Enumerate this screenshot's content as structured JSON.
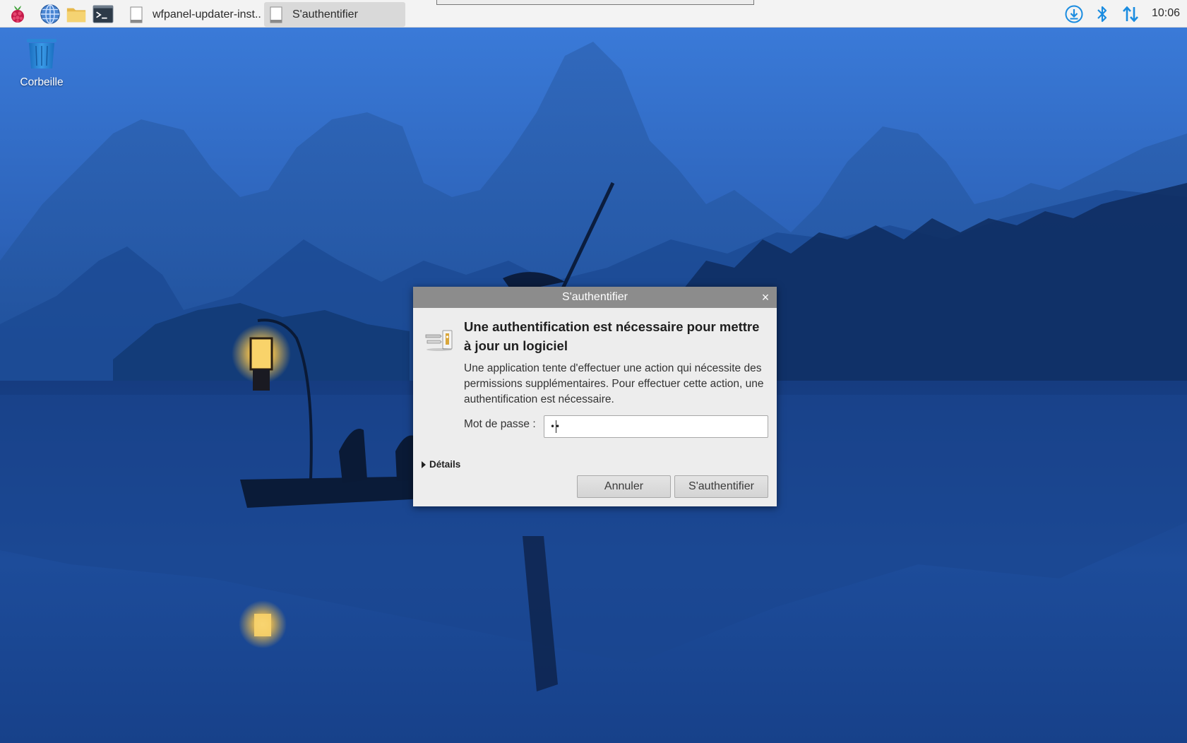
{
  "taskbar": {
    "launchers": [
      {
        "name": "raspberry-menu-icon"
      },
      {
        "name": "web-browser-icon"
      },
      {
        "name": "file-manager-icon"
      },
      {
        "name": "terminal-icon"
      }
    ],
    "tasks": [
      {
        "label": "wfpanel-updater-inst..",
        "active": false
      },
      {
        "label": "S'authentifier",
        "active": true
      }
    ],
    "tray": [
      {
        "name": "updater-download-icon"
      },
      {
        "name": "bluetooth-icon"
      },
      {
        "name": "network-updown-icon"
      }
    ],
    "clock": "10:06"
  },
  "desktop": {
    "icons": [
      {
        "label": "Corbeille",
        "icon": "trash-icon"
      }
    ]
  },
  "dialog": {
    "title": "S'authentifier",
    "close_label": "×",
    "heading": "Une authentification est nécessaire pour mettre à jour un logiciel",
    "body": "Une application tente d'effectuer une action qui nécessite des permissions supplémentaires. Pour effectuer cette action, une authentification est nécessaire.",
    "password_label": "Mot de passe :",
    "password_value": "••",
    "details_label": "Détails",
    "cancel_label": "Annuler",
    "auth_label": "S'authentifier"
  },
  "colors": {
    "taskbar_bg": "#f3f3f3",
    "dialog_bg": "#ededed",
    "titlebar_bg": "#8c8c8c",
    "tray_blue": "#1a8ce0"
  }
}
